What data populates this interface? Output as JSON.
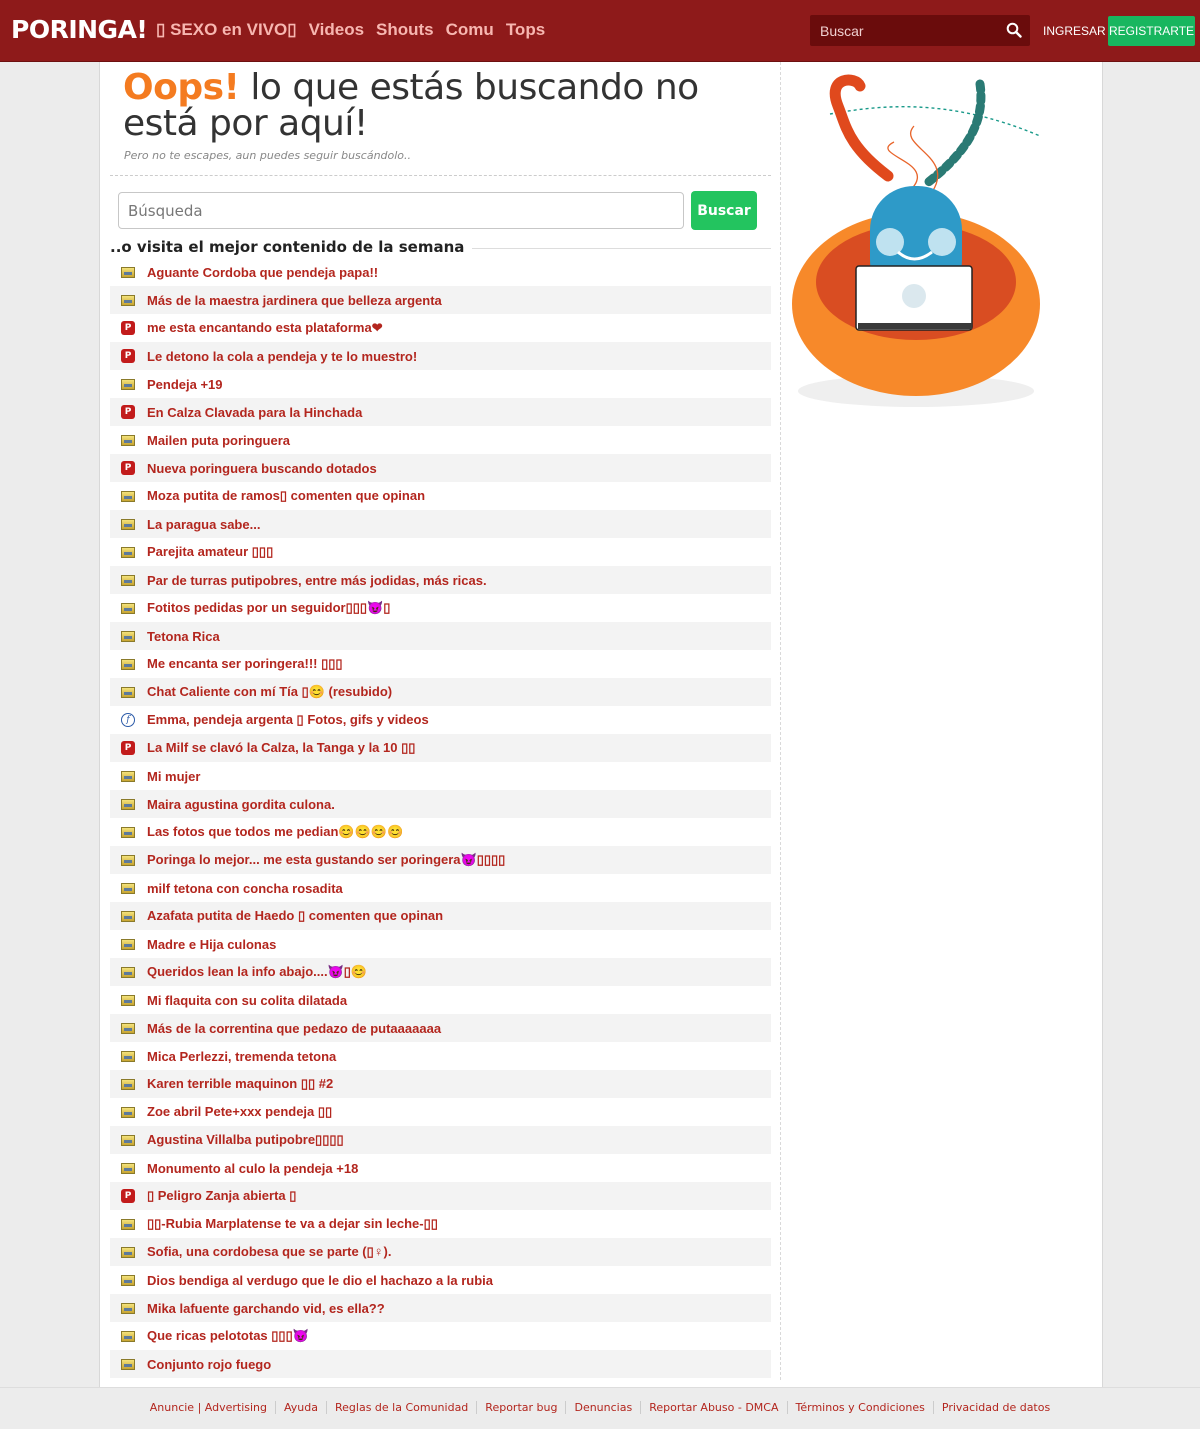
{
  "header": {
    "logo": "PORINGA!",
    "nav": [
      "▯ SEXO en VIVO▯",
      "Videos",
      "Shouts",
      "Comu",
      "Tops"
    ],
    "search_placeholder": "Buscar",
    "login_label": "INGRESAR",
    "register_label": "REGISTRARTE"
  },
  "error": {
    "title_accent": "Oops!",
    "title_rest": " lo que estás buscando no está por aquí!",
    "subtitle": "Pero no te escapes, aun puedes seguir buscándolo..",
    "search_placeholder": "Búsqueda",
    "search_button": "Buscar"
  },
  "week": {
    "title": "..o visita el mejor contenido de la semana",
    "items": [
      {
        "icon": "image",
        "title": "Aguante Cordoba que pendeja papa!!"
      },
      {
        "icon": "image",
        "title": "Más de la maestra jardinera que belleza argenta"
      },
      {
        "icon": "poringa",
        "title": "me esta encantando esta plataforma❤"
      },
      {
        "icon": "poringa",
        "title": "Le detono la cola a pendeja y te lo muestro!"
      },
      {
        "icon": "image",
        "title": "Pendeja +19"
      },
      {
        "icon": "poringa",
        "title": "En Calza Clavada para la Hinchada"
      },
      {
        "icon": "image",
        "title": "Mailen puta poringuera"
      },
      {
        "icon": "poringa",
        "title": "Nueva poringuera buscando dotados"
      },
      {
        "icon": "image",
        "title": "Moza putita de ramos▯ comenten que opinan"
      },
      {
        "icon": "image",
        "title": "La paragua sabe..."
      },
      {
        "icon": "image",
        "title": "Parejita amateur ▯▯▯"
      },
      {
        "icon": "image",
        "title": "Par de turras putipobres, entre más jodidas, más ricas."
      },
      {
        "icon": "image",
        "title": "Fotitos pedidas por un seguidor▯▯▯😈▯"
      },
      {
        "icon": "image",
        "title": "Tetona Rica"
      },
      {
        "icon": "image",
        "title": "Me encanta ser poringera!!! ▯▯▯"
      },
      {
        "icon": "image",
        "title": "Chat Caliente con mí Tía ▯😊 (resubido)"
      },
      {
        "icon": "flash",
        "title": "Emma, pendeja argenta ▯ Fotos, gifs y videos"
      },
      {
        "icon": "poringa",
        "title": "La Milf se clavó la Calza, la Tanga y la 10 ▯▯"
      },
      {
        "icon": "image",
        "title": "Mi mujer"
      },
      {
        "icon": "image",
        "title": "Maira agustina gordita culona."
      },
      {
        "icon": "image",
        "title": "Las fotos que todos me pedian😊😊😊😊"
      },
      {
        "icon": "image",
        "title": "Poringa lo mejor... me esta gustando ser poringera😈▯▯▯▯"
      },
      {
        "icon": "image",
        "title": "milf tetona con concha rosadita"
      },
      {
        "icon": "image",
        "title": "Azafata putita de Haedo ▯ comenten que opinan"
      },
      {
        "icon": "image",
        "title": "Madre e Hija culonas"
      },
      {
        "icon": "image",
        "title": "Queridos lean la info abajo....😈▯😊"
      },
      {
        "icon": "image",
        "title": "Mi flaquita con su colita dilatada"
      },
      {
        "icon": "image",
        "title": "Más de la correntina que pedazo de putaaaaaaa"
      },
      {
        "icon": "image",
        "title": "Mica Perlezzi, tremenda tetona"
      },
      {
        "icon": "image",
        "title": "Karen terrible maquinon ▯▯ #2"
      },
      {
        "icon": "image",
        "title": "Zoe abril Pete+xxx pendeja ▯▯"
      },
      {
        "icon": "image",
        "title": "Agustina Villalba putipobre▯▯▯▯"
      },
      {
        "icon": "image",
        "title": "Monumento al culo la pendeja +18"
      },
      {
        "icon": "poringa",
        "title": "▯ Peligro Zanja abierta ▯"
      },
      {
        "icon": "image",
        "title": "▯▯-Rubia Marplatense te va a dejar sin leche-▯▯"
      },
      {
        "icon": "image",
        "title": "Sofia, una cordobesa que se parte (▯♀)."
      },
      {
        "icon": "image",
        "title": "Dios bendiga al verdugo que le dio el hachazo a la rubia"
      },
      {
        "icon": "image",
        "title": "Mika lafuente garchando vid, es ella??"
      },
      {
        "icon": "image",
        "title": "Que ricas pelototas ▯▯▯😈"
      },
      {
        "icon": "image",
        "title": "Conjunto rojo fuego"
      }
    ]
  },
  "footer": {
    "links": [
      "Anuncie | Advertising",
      "Ayuda",
      "Reglas de la Comunidad",
      "Reportar bug",
      "Denuncias",
      "Reportar Abuso - DMCA",
      "Términos y Condiciones",
      "Privacidad de datos"
    ]
  },
  "icon_glyphs": {
    "poringa": "P",
    "flash": "f"
  },
  "colors": {
    "header_bg": "#8e1a1a",
    "accent_orange": "#f47b20",
    "link_red": "#b3261e",
    "button_green": "#23c45f"
  }
}
